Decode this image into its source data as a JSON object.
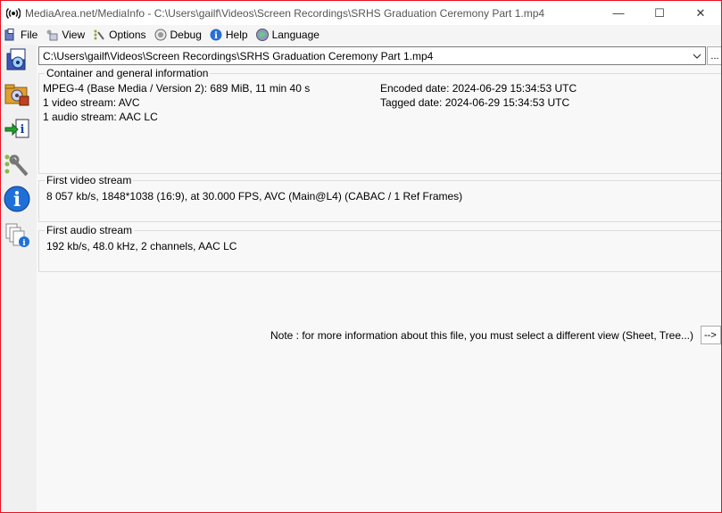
{
  "window": {
    "title": "MediaArea.net/MediaInfo - C:\\Users\\gailf\\Videos\\Screen Recordings\\SRHS Graduation Ceremony Part 1.mp4",
    "minimize": "—",
    "maximize": "☐",
    "close": "✕"
  },
  "menu": {
    "items": [
      {
        "label": "File",
        "icon": "file-icon"
      },
      {
        "label": "View",
        "icon": "view-icon"
      },
      {
        "label": "Options",
        "icon": "options-icon"
      },
      {
        "label": "Debug",
        "icon": "debug-icon"
      },
      {
        "label": "Help",
        "icon": "help-icon"
      },
      {
        "label": "Language",
        "icon": "language-icon"
      }
    ]
  },
  "toolbar": {
    "buttons": [
      {
        "name": "open-file-icon"
      },
      {
        "name": "open-folder-icon"
      },
      {
        "name": "export-icon"
      },
      {
        "name": "preferences-icon"
      },
      {
        "name": "about-icon"
      },
      {
        "name": "knowledge-icon"
      }
    ]
  },
  "file_selector": {
    "value": "C:\\Users\\gailf\\Videos\\Screen Recordings\\SRHS Graduation Ceremony Part 1.mp4",
    "browse_label": "..."
  },
  "general": {
    "title": "Container and general information",
    "format": "MPEG-4 (Base Media / Version 2): 689 MiB, 11 min 40 s",
    "video_count": "1 video stream: AVC",
    "audio_count": "1 audio stream: AAC LC",
    "encoded_date": "Encoded date: 2024-06-29 15:34:53 UTC",
    "tagged_date": "Tagged date: 2024-06-29 15:34:53 UTC"
  },
  "video": {
    "title": "First video stream",
    "details": "8 057 kb/s, 1848*1038 (16:9), at 30.000 FPS, AVC (Main@L4) (CABAC / 1 Ref Frames)"
  },
  "audio": {
    "title": "First audio stream",
    "details": "192 kb/s, 48.0 kHz, 2 channels, AAC LC"
  },
  "note": {
    "text": "Note : for more information about this file, you must select a different view (Sheet, Tree...)",
    "button_label": "-->"
  }
}
